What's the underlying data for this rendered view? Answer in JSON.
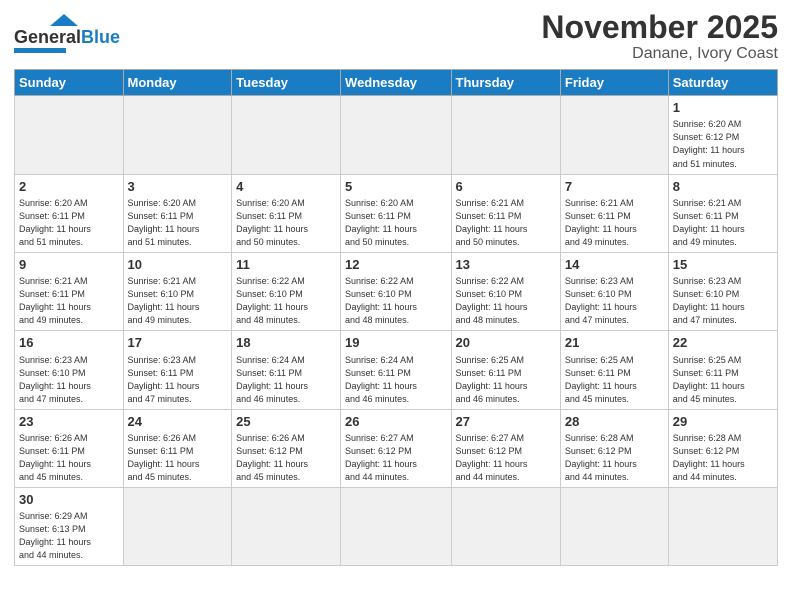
{
  "logo": {
    "text_general": "General",
    "text_blue": "Blue"
  },
  "title": "November 2025",
  "subtitle": "Danane, Ivory Coast",
  "days_of_week": [
    "Sunday",
    "Monday",
    "Tuesday",
    "Wednesday",
    "Thursday",
    "Friday",
    "Saturday"
  ],
  "weeks": [
    [
      {
        "day": "",
        "info": ""
      },
      {
        "day": "",
        "info": ""
      },
      {
        "day": "",
        "info": ""
      },
      {
        "day": "",
        "info": ""
      },
      {
        "day": "",
        "info": ""
      },
      {
        "day": "",
        "info": ""
      },
      {
        "day": "1",
        "info": "Sunrise: 6:20 AM\nSunset: 6:12 PM\nDaylight: 11 hours\nand 51 minutes."
      }
    ],
    [
      {
        "day": "2",
        "info": "Sunrise: 6:20 AM\nSunset: 6:11 PM\nDaylight: 11 hours\nand 51 minutes."
      },
      {
        "day": "3",
        "info": "Sunrise: 6:20 AM\nSunset: 6:11 PM\nDaylight: 11 hours\nand 51 minutes."
      },
      {
        "day": "4",
        "info": "Sunrise: 6:20 AM\nSunset: 6:11 PM\nDaylight: 11 hours\nand 50 minutes."
      },
      {
        "day": "5",
        "info": "Sunrise: 6:20 AM\nSunset: 6:11 PM\nDaylight: 11 hours\nand 50 minutes."
      },
      {
        "day": "6",
        "info": "Sunrise: 6:21 AM\nSunset: 6:11 PM\nDaylight: 11 hours\nand 50 minutes."
      },
      {
        "day": "7",
        "info": "Sunrise: 6:21 AM\nSunset: 6:11 PM\nDaylight: 11 hours\nand 49 minutes."
      },
      {
        "day": "8",
        "info": "Sunrise: 6:21 AM\nSunset: 6:11 PM\nDaylight: 11 hours\nand 49 minutes."
      }
    ],
    [
      {
        "day": "9",
        "info": "Sunrise: 6:21 AM\nSunset: 6:11 PM\nDaylight: 11 hours\nand 49 minutes."
      },
      {
        "day": "10",
        "info": "Sunrise: 6:21 AM\nSunset: 6:10 PM\nDaylight: 11 hours\nand 49 minutes."
      },
      {
        "day": "11",
        "info": "Sunrise: 6:22 AM\nSunset: 6:10 PM\nDaylight: 11 hours\nand 48 minutes."
      },
      {
        "day": "12",
        "info": "Sunrise: 6:22 AM\nSunset: 6:10 PM\nDaylight: 11 hours\nand 48 minutes."
      },
      {
        "day": "13",
        "info": "Sunrise: 6:22 AM\nSunset: 6:10 PM\nDaylight: 11 hours\nand 48 minutes."
      },
      {
        "day": "14",
        "info": "Sunrise: 6:23 AM\nSunset: 6:10 PM\nDaylight: 11 hours\nand 47 minutes."
      },
      {
        "day": "15",
        "info": "Sunrise: 6:23 AM\nSunset: 6:10 PM\nDaylight: 11 hours\nand 47 minutes."
      }
    ],
    [
      {
        "day": "16",
        "info": "Sunrise: 6:23 AM\nSunset: 6:10 PM\nDaylight: 11 hours\nand 47 minutes."
      },
      {
        "day": "17",
        "info": "Sunrise: 6:23 AM\nSunset: 6:11 PM\nDaylight: 11 hours\nand 47 minutes."
      },
      {
        "day": "18",
        "info": "Sunrise: 6:24 AM\nSunset: 6:11 PM\nDaylight: 11 hours\nand 46 minutes."
      },
      {
        "day": "19",
        "info": "Sunrise: 6:24 AM\nSunset: 6:11 PM\nDaylight: 11 hours\nand 46 minutes."
      },
      {
        "day": "20",
        "info": "Sunrise: 6:25 AM\nSunset: 6:11 PM\nDaylight: 11 hours\nand 46 minutes."
      },
      {
        "day": "21",
        "info": "Sunrise: 6:25 AM\nSunset: 6:11 PM\nDaylight: 11 hours\nand 45 minutes."
      },
      {
        "day": "22",
        "info": "Sunrise: 6:25 AM\nSunset: 6:11 PM\nDaylight: 11 hours\nand 45 minutes."
      }
    ],
    [
      {
        "day": "23",
        "info": "Sunrise: 6:26 AM\nSunset: 6:11 PM\nDaylight: 11 hours\nand 45 minutes."
      },
      {
        "day": "24",
        "info": "Sunrise: 6:26 AM\nSunset: 6:11 PM\nDaylight: 11 hours\nand 45 minutes."
      },
      {
        "day": "25",
        "info": "Sunrise: 6:26 AM\nSunset: 6:12 PM\nDaylight: 11 hours\nand 45 minutes."
      },
      {
        "day": "26",
        "info": "Sunrise: 6:27 AM\nSunset: 6:12 PM\nDaylight: 11 hours\nand 44 minutes."
      },
      {
        "day": "27",
        "info": "Sunrise: 6:27 AM\nSunset: 6:12 PM\nDaylight: 11 hours\nand 44 minutes."
      },
      {
        "day": "28",
        "info": "Sunrise: 6:28 AM\nSunset: 6:12 PM\nDaylight: 11 hours\nand 44 minutes."
      },
      {
        "day": "29",
        "info": "Sunrise: 6:28 AM\nSunset: 6:12 PM\nDaylight: 11 hours\nand 44 minutes."
      }
    ],
    [
      {
        "day": "30",
        "info": "Sunrise: 6:29 AM\nSunset: 6:13 PM\nDaylight: 11 hours\nand 44 minutes."
      },
      {
        "day": "",
        "info": ""
      },
      {
        "day": "",
        "info": ""
      },
      {
        "day": "",
        "info": ""
      },
      {
        "day": "",
        "info": ""
      },
      {
        "day": "",
        "info": ""
      },
      {
        "day": "",
        "info": ""
      }
    ]
  ]
}
